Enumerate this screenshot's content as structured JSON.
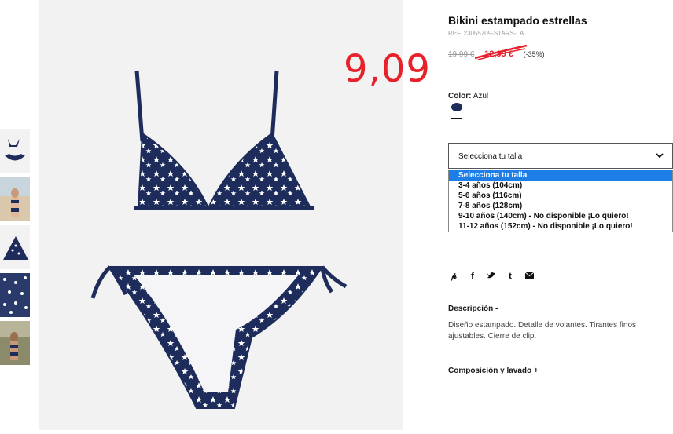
{
  "product": {
    "title": "Bikini estampado estrellas",
    "ref": "REF. 23055709-STARS-LA",
    "old_price": "19,99 €",
    "new_price": "12,99 €",
    "discount": "(-35%)",
    "handwritten_price": "9,09"
  },
  "color": {
    "label": "Color:",
    "value": "Azul",
    "swatch_color": "#1d2c5a"
  },
  "size_select": {
    "selected": "Selecciona tu talla",
    "options": [
      "Selecciona tu talla",
      "3-4 años (104cm)",
      "5-6 años (116cm)",
      "7-8 años (128cm)",
      "9-10 años (140cm) - No disponible ¡Lo quiero!",
      "11-12 años (152cm) - No disponible ¡Lo quiero!"
    ]
  },
  "share_icons": [
    "pinterest-icon",
    "facebook-icon",
    "twitter-icon",
    "tumblr-icon",
    "email-icon"
  ],
  "description": {
    "heading": "Descripción -",
    "text": "Diseño estampado. Detalle de volantes. Tirantes finos ajustables. Cierre de clip."
  },
  "composition": {
    "heading": "Composición y lavado +"
  },
  "colors": {
    "accent_red": "#e8202a",
    "navy": "#1d2c5a",
    "select_highlight": "#1e7ee8"
  }
}
